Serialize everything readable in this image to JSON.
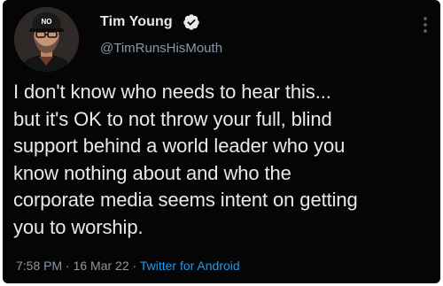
{
  "user": {
    "display_name": "Tim Young",
    "handle": "@TimRunsHisMouth",
    "avatar_cap_text": "NO"
  },
  "tweet": {
    "text": "I don't know who needs to hear this...\nbut it's OK to not throw your full, blind\nsupport behind a world leader who you\nknow nothing about and who the\ncorporate media seems intent on getting\nyou to worship.",
    "time": "7:58 PM",
    "separator_1": " · ",
    "date": "16 Mar 22",
    "separator_2": " · ",
    "source": "Twitter for Android"
  },
  "icons": {
    "verified": "verified-badge-icon",
    "more": "more-vertical-icon"
  },
  "colors": {
    "background": "#050505",
    "text_primary": "#e7e9ea",
    "text_secondary": "#8b98a5",
    "accent": "#1d9bf0"
  }
}
